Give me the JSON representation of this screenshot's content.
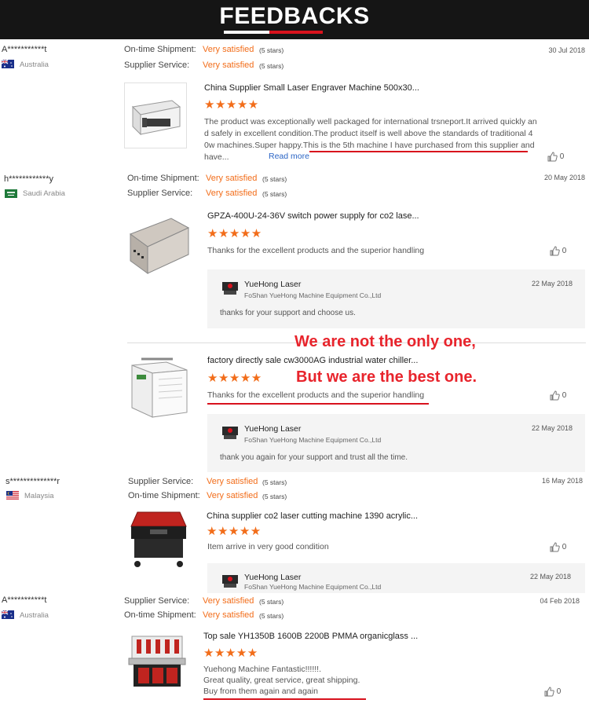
{
  "header": {
    "title": "FEEDBACKS"
  },
  "colors": {
    "accent": "#f26d1a",
    "underline": "#d8121d",
    "promo": "#e8242c",
    "link": "#2a64c5"
  },
  "icons": {
    "rating": "star-icon",
    "like": "thumbs-up-icon",
    "seller": "seller-logo-icon"
  },
  "reviews": [
    {
      "user": "A***********t",
      "country": "Australia",
      "date": "30 Jul 2018",
      "rating_lines": [
        {
          "label": "On-time Shipment:",
          "value": "Very satisfied",
          "stars": "(5 stars)"
        },
        {
          "label": "Supplier Service:",
          "value": "Very satisfied",
          "stars": "(5 stars)"
        }
      ],
      "product_title": "China Supplier Small Laser Engraver Machine 500x30...",
      "rating": 5,
      "text_lines": [
        "The product was exceptionally well packaged for international trsneport.It arrived quickly an",
        "d safely in excellent condition.The product itself is well above the standards of traditional 4",
        "0w machines.Super happy.This is the 5th machine I have purchased from this supplier and",
        "have..."
      ],
      "read_more": "Read more",
      "likes": "0"
    },
    {
      "user": "h************y",
      "country": "Saudi Arabia",
      "date": "20 May 2018",
      "rating_lines": [
        {
          "label": "On-time Shipment:",
          "value": "Very satisfied",
          "stars": "(5 stars)"
        },
        {
          "label": "Supplier Service:",
          "value": "Very satisfied",
          "stars": "(5 stars)"
        }
      ],
      "products": [
        {
          "title": "GPZA-400U-24-36V switch power supply for co2 lase...",
          "rating": 5,
          "text": "Thanks for the excellent products and the superior handling",
          "likes": "0",
          "reply": {
            "name": "YueHong Laser",
            "company": "FoShan YueHong Machine Equipment Co.,Ltd",
            "date": "22 May 2018",
            "text": "thanks for your support and choose us."
          }
        },
        {
          "title": "factory directly sale cw3000AG industrial water chiller...",
          "rating": 5,
          "text": "Thanks for the excellent products and the superior handling",
          "likes": "0",
          "reply": {
            "name": "YueHong Laser",
            "company": "FoShan YueHong Machine Equipment Co.,Ltd",
            "date": "22 May 2018",
            "text": "thank you again for your support and trust all the time."
          }
        }
      ]
    },
    {
      "user": "s**************r",
      "country": "Malaysia",
      "date": "16 May 2018",
      "rating_lines": [
        {
          "label": "Supplier Service:",
          "value": "Very satisfied",
          "stars": "(5 stars)"
        },
        {
          "label": "On-time Shipment:",
          "value": "Very satisfied",
          "stars": "(5 stars)"
        }
      ],
      "product_title": "China supplier co2 laser cutting machine 1390 acrylic...",
      "rating": 5,
      "text": "Item arrive in very good condition",
      "likes": "0",
      "reply": {
        "name": "YueHong Laser",
        "company": "FoShan YueHong Machine Equipment Co.,Ltd",
        "date": "22 May 2018"
      }
    },
    {
      "user": "A***********t",
      "country": "Australia",
      "date": "04 Feb 2018",
      "rating_lines": [
        {
          "label": "Supplier Service:",
          "value": "Very satisfied",
          "stars": "(5 stars)"
        },
        {
          "label": "On-time Shipment:",
          "value": "Very satisfied",
          "stars": "(5 stars)"
        }
      ],
      "product_title": "Top sale YH1350B 1600B 2200B PMMA organicglass ...",
      "rating": 5,
      "text_lines": [
        "Yuehong Machine Fantastic!!!!!!.",
        "Great quality, great service, great shipping.",
        "Buy from them again and again"
      ],
      "likes": "0"
    }
  ],
  "promo": {
    "line1": "We are not the only one,",
    "line2": "But we are the best one."
  },
  "star_char": "★★★★★"
}
